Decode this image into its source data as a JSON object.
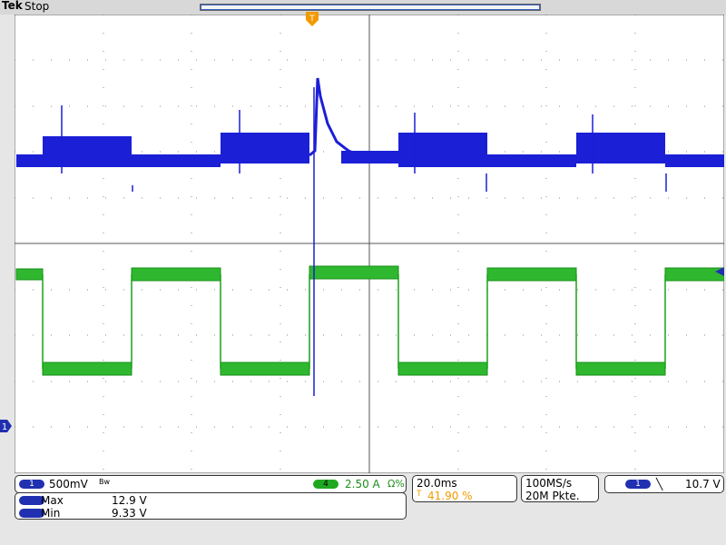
{
  "header": {
    "brand": "Tek",
    "state": "Stop"
  },
  "colors": {
    "ch1": "#1b1fd6",
    "ch4": "#1fb41f",
    "trigger": "#f29a00",
    "grid": "#555555"
  },
  "icons": {
    "trigger_position": "trigger-position-icon",
    "ground": "ch1-ground-icon",
    "edge": "falling-edge-icon"
  },
  "ch1": {
    "number": "1",
    "scale": "500mV",
    "bw_mark": "Bw"
  },
  "ch4": {
    "number": "4",
    "scale": "2.50 A",
    "units_mark": "Ω%"
  },
  "timebase": {
    "scale": "20.0ms",
    "trigger_pos": "41.90 %"
  },
  "acquisition": {
    "rate": "100MS/s",
    "record_length": "20M Pkte."
  },
  "trigger": {
    "source": "1",
    "level": "10.7 V"
  },
  "measurements": [
    {
      "label": "Max",
      "value": "12.9 V"
    },
    {
      "label": "Min",
      "value": "9.33 V"
    }
  ]
}
